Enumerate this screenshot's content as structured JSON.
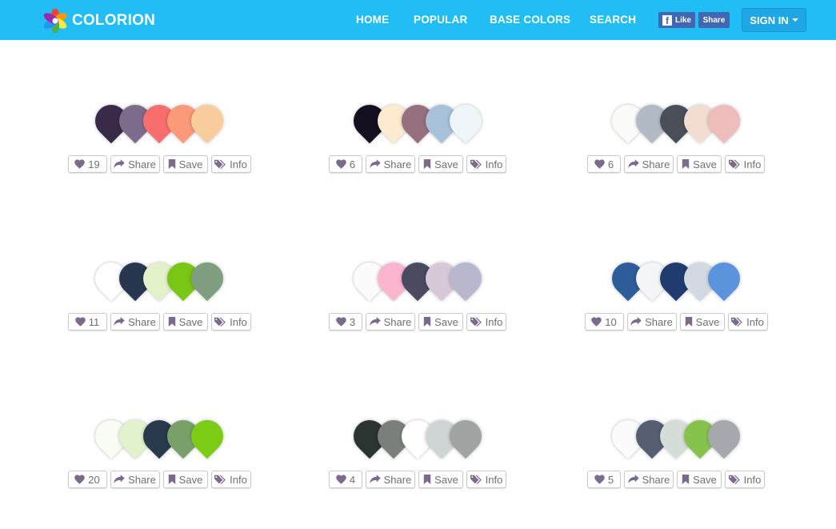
{
  "nav": {
    "brand": "COLORION",
    "links": [
      "HOME",
      "POPULAR",
      "BASE COLORS",
      "SEARCH"
    ],
    "fb_like": "Like",
    "fb_share": "Share",
    "sign_in": "SIGN IN"
  },
  "colors": {
    "navbar": "#21bdf5",
    "icon": "#7b6a8c"
  },
  "palettes": [
    {
      "likes": "19",
      "share": "Share",
      "save": "Save",
      "info": "Info",
      "swatches": [
        "#3a2a4a",
        "#7d6b8c",
        "#f86e6e",
        "#fa9a78",
        "#f8cc9c"
      ]
    },
    {
      "likes": "6",
      "share": "Share",
      "save": "Save",
      "info": "Info",
      "swatches": [
        "#15101f",
        "#fdead0",
        "#96707f",
        "#a6c1d8",
        "#eef5f9"
      ]
    },
    {
      "likes": "6",
      "share": "Share",
      "save": "Save",
      "info": "Info",
      "swatches": [
        "#fafaf8",
        "#b2bac6",
        "#4a4e57",
        "#f3ddd2",
        "#efbcbc"
      ]
    },
    {
      "likes": "11",
      "share": "Share",
      "save": "Save",
      "info": "Info",
      "swatches": [
        "#ffffff",
        "#28374f",
        "#e2f1c8",
        "#7ac614",
        "#7f9d7f"
      ]
    },
    {
      "likes": "3",
      "share": "Share",
      "save": "Save",
      "info": "Info",
      "swatches": [
        "#fbfbfb",
        "#fbb5d0",
        "#4a4a61",
        "#d7c9d7",
        "#b7b8ce"
      ]
    },
    {
      "likes": "10",
      "share": "Share",
      "save": "Save",
      "info": "Info",
      "swatches": [
        "#2c5c9a",
        "#f3f5f6",
        "#203c6e",
        "#d3d9e0",
        "#5b93dc"
      ]
    },
    {
      "likes": "20",
      "share": "Share",
      "save": "Save",
      "info": "Info",
      "swatches": [
        "#f8fcf5",
        "#e2f2cc",
        "#283a4c",
        "#7aa06a",
        "#7ccb14"
      ]
    },
    {
      "likes": "4",
      "share": "Share",
      "save": "Save",
      "info": "Info",
      "swatches": [
        "#2b3430",
        "#7a7f7a",
        "#ffffff",
        "#cfd4d4",
        "#a0a4a2"
      ]
    },
    {
      "likes": "5",
      "share": "Share",
      "save": "Save",
      "info": "Info",
      "swatches": [
        "#fbfbfb",
        "#565f72",
        "#d5ddd9",
        "#86c24c",
        "#a5a9ae"
      ]
    }
  ]
}
